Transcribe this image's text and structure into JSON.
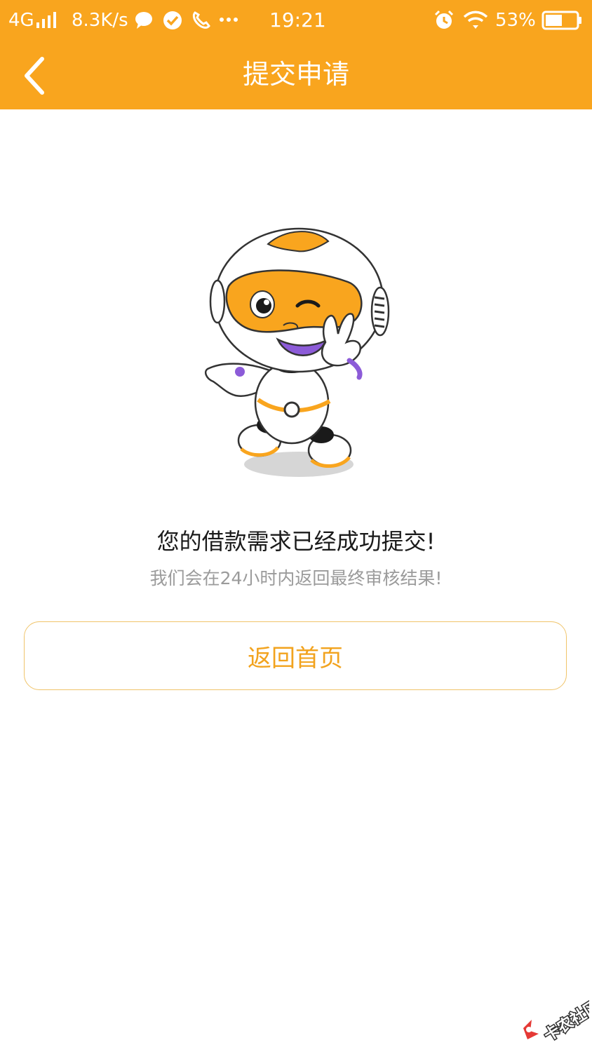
{
  "status_bar": {
    "network": "4G",
    "speed": "8.3K/s",
    "time": "19:21",
    "battery": "53%",
    "icons": [
      "signal-icon",
      "chat-icon",
      "check-circle-icon",
      "phone-icon",
      "more-dots-icon",
      "alarm-icon",
      "wifi-icon",
      "battery-icon"
    ]
  },
  "nav": {
    "title": "提交申请",
    "back_icon": "chevron-left-icon"
  },
  "result": {
    "title": "您的借款需求已经成功提交!",
    "subtitle": "我们会在24小时内返回最终审核结果!"
  },
  "actions": {
    "home_label": "返回首页"
  },
  "watermark": {
    "text": "卡农社区"
  },
  "colors": {
    "brand": "#F9A51E",
    "button_text": "#F2A31E",
    "button_border": "#F0C46A",
    "title_text": "#1a1a1a",
    "subtitle_text": "#9b9b9b",
    "mascot_purple": "#8C5BD8"
  }
}
